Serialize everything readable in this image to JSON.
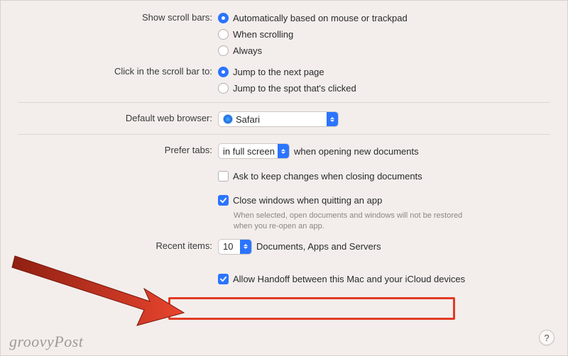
{
  "scrollBars": {
    "label": "Show scroll bars:",
    "options": {
      "auto": "Automatically based on mouse or trackpad",
      "scrolling": "When scrolling",
      "always": "Always"
    }
  },
  "clickScroll": {
    "label": "Click in the scroll bar to:",
    "options": {
      "nextPage": "Jump to the next page",
      "spot": "Jump to the spot that's clicked"
    }
  },
  "defaultBrowser": {
    "label": "Default web browser:",
    "value": "Safari"
  },
  "preferTabs": {
    "label": "Prefer tabs:",
    "value": "in full screen",
    "suffix": "when opening new documents"
  },
  "askKeepChanges": {
    "label": "Ask to keep changes when closing documents"
  },
  "closeWindows": {
    "label": "Close windows when quitting an app",
    "hint": "When selected, open documents and windows will not be restored when you re-open an app."
  },
  "recentItems": {
    "label": "Recent items:",
    "value": "10",
    "suffix": "Documents, Apps and Servers"
  },
  "handoff": {
    "label": "Allow Handoff between this Mac and your iCloud devices"
  },
  "help": "?",
  "watermark": "groovyPost"
}
